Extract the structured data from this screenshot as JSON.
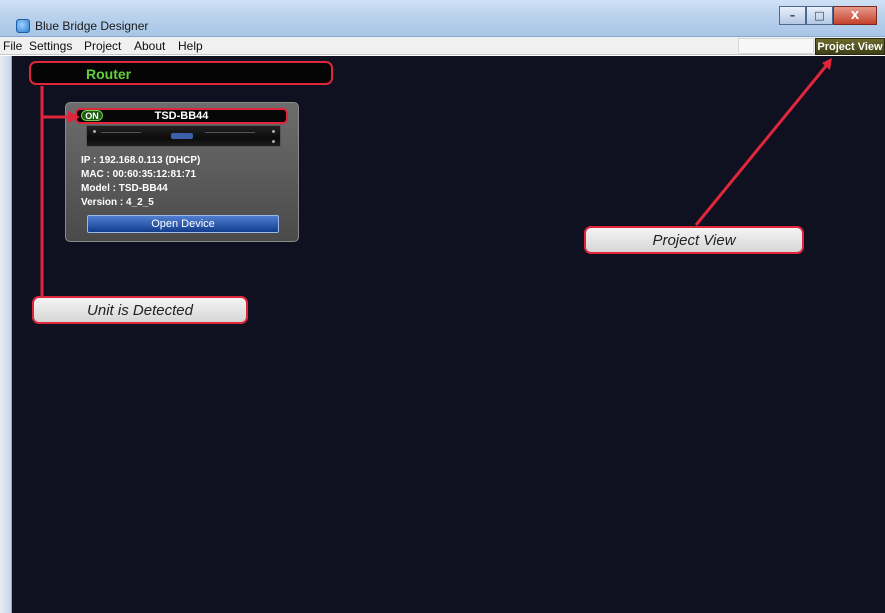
{
  "window": {
    "title": "Blue Bridge Designer",
    "minimize": "–",
    "maximize": "□",
    "close": "X"
  },
  "menu": {
    "items": [
      "File",
      "Settings",
      "Project",
      "About",
      "Help"
    ]
  },
  "view_toggle": {
    "project_view_label": "Project View"
  },
  "router": {
    "label": "Router"
  },
  "device": {
    "status": "ON",
    "name": "TSD-BB44",
    "ip": "IP : 192.168.0.113 (DHCP)",
    "mac": "MAC : 00:60:35:12:81:71",
    "model": "Model : TSD-BB44",
    "version": "Version : 4_2_5",
    "open_button": "Open Device"
  },
  "callouts": {
    "unit_detected": "Unit is Detected",
    "project_view": "Project View"
  },
  "colors": {
    "canvas_bg": "#0f1120",
    "annotation_red": "#e0263a",
    "router_label_green": "#5fd13a"
  }
}
